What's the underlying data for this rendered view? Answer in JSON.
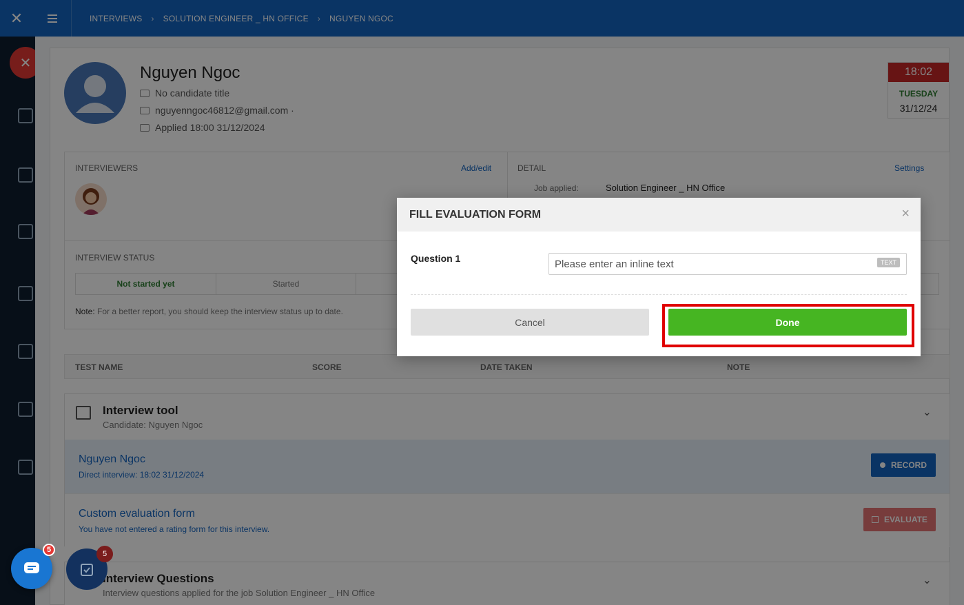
{
  "topbar": {
    "breadcrumbs": [
      "INTERVIEWS",
      "SOLUTION ENGINEER _ HN OFFICE",
      "NGUYEN NGOC"
    ]
  },
  "candidate": {
    "name": "Nguyen Ngoc",
    "title": "No candidate title",
    "email": "nguyenngoc46812@gmail.com ·",
    "applied": "Applied 18:00 31/12/2024"
  },
  "date_box": {
    "time": "18:02",
    "weekday": "TUESDAY",
    "date": "31/12/24"
  },
  "interviewers": {
    "heading": "INTERVIEWERS",
    "add_edit": "Add/edit"
  },
  "detail": {
    "heading": "DETAIL",
    "settings": "Settings",
    "job_applied_label": "Job applied:",
    "job_applied_value": "Solution Engineer _ HN Office"
  },
  "interview_status": {
    "heading": "INTERVIEW STATUS",
    "options": [
      "Not started yet",
      "Started"
    ],
    "note_label": "Note:",
    "note_text": "For a better report, you should keep the interview status up to date."
  },
  "tests_table": {
    "columns": [
      "TEST NAME",
      "SCORE",
      "DATE TAKEN",
      "NOTE"
    ]
  },
  "interview_tool": {
    "title": "Interview tool",
    "subtitle": "Candidate: Nguyen Ngoc",
    "row1_title": "Nguyen Ngoc",
    "row1_sub": "Direct interview: 18:02 31/12/2024",
    "record_label": "RECORD",
    "row2_title": "Custom evaluation form",
    "row2_sub": "You have not entered a rating form for this interview.",
    "evaluate_label": "EVALUATE"
  },
  "interview_questions": {
    "title": "Interview Questions",
    "subtitle": "Interview questions applied for the job Solution Engineer _ HN Office"
  },
  "badges": {
    "chat_count": "5",
    "task_count": "5"
  },
  "modal": {
    "title": "FILL EVALUATION FORM",
    "question_label": "Question 1",
    "input_placeholder": "Please enter an inline text",
    "input_type_tag": "TEXT",
    "cancel_label": "Cancel",
    "done_label": "Done"
  },
  "colors": {
    "brand_blue": "#1565c0",
    "done_green": "#46b522",
    "highlight_red": "#e00000"
  }
}
